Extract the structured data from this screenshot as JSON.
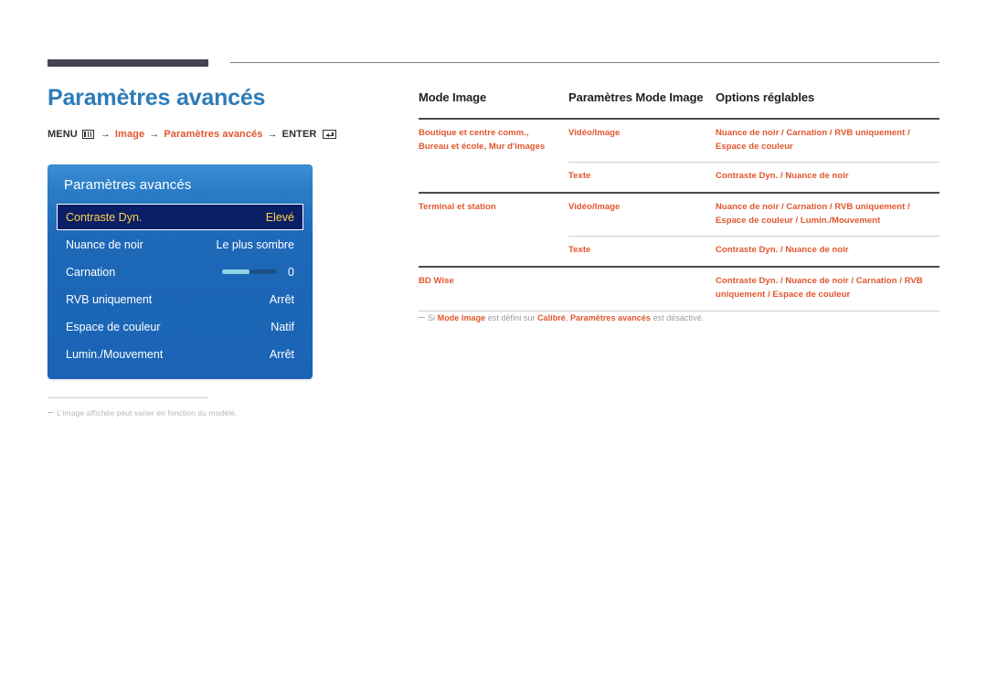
{
  "page": {
    "title": "Paramètres avancés"
  },
  "breadcrumb": {
    "menu_label": "MENU",
    "menu_icon": "menu-grid-icon",
    "arrow": "→",
    "item1": "Image",
    "item2": "Paramètres avancés",
    "enter_label": "ENTER",
    "enter_icon": "enter-return-icon"
  },
  "osd": {
    "title": "Paramètres avancés",
    "rows": [
      {
        "label": "Contraste Dyn.",
        "value": "Elevé",
        "selected": true,
        "type": "value"
      },
      {
        "label": "Nuance de noir",
        "value": "Le plus sombre",
        "selected": false,
        "type": "value"
      },
      {
        "label": "Carnation",
        "value": "0",
        "selected": false,
        "type": "slider",
        "slider_percent": 50
      },
      {
        "label": "RVB uniquement",
        "value": "Arrêt",
        "selected": false,
        "type": "value"
      },
      {
        "label": "Espace de couleur",
        "value": "Natif",
        "selected": false,
        "type": "value"
      },
      {
        "label": "Lumin./Mouvement",
        "value": "Arrêt",
        "selected": false,
        "type": "value"
      }
    ]
  },
  "left_note": {
    "text": "L'image affichée peut varier en fonction du modèle."
  },
  "table": {
    "headers": [
      "Mode Image",
      "Paramètres Mode Image",
      "Options réglables"
    ],
    "rows": [
      {
        "mode": "Boutique et centre comm., Bureau et école, Mur d'images",
        "setting": "Vidéo/Image",
        "options": "Nuance de noir / Carnation / RVB uniquement / Espace de couleur"
      },
      {
        "mode": "",
        "setting": "Texte",
        "options": "Contraste Dyn. / Nuance de noir"
      },
      {
        "mode": "Terminal et station",
        "setting": "Vidéo/Image",
        "options": "Nuance de noir / Carnation / RVB uniquement / Espace de couleur / Lumin./Mouvement"
      },
      {
        "mode": "",
        "setting": "Texte",
        "options": "Contraste Dyn. / Nuance de noir"
      },
      {
        "mode": "BD Wise",
        "setting": "",
        "options": "Contraste Dyn. / Nuance de noir / Carnation / RVB uniquement / Espace de couleur"
      }
    ]
  },
  "table_note": {
    "part1": "Si ",
    "bold1": "Mode Image",
    "part2": " est défini sur ",
    "bold2": "Calibré",
    "part3": ", ",
    "bold3": "Paramètres avancés",
    "part4": " est désactivé."
  },
  "colors": {
    "title_blue": "#2e7cb8",
    "accent_orange": "#e0562c",
    "osd_blue": "#1e68b8",
    "osd_selected_bg": "#0a1f66",
    "osd_selected_text": "#ffd24a",
    "rule_dark": "#454150"
  }
}
